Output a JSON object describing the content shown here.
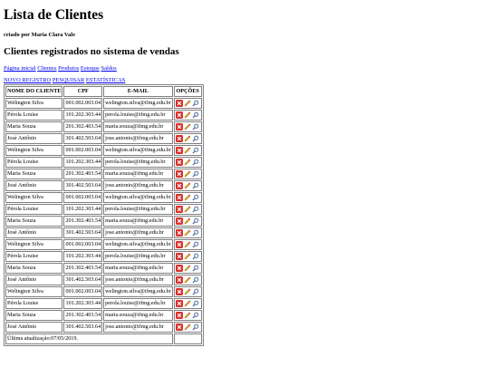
{
  "page": {
    "title": "Lista de Clientes",
    "author": "criado por Maria Clara Vale",
    "subtitle": "Clientes registrados no sistema de vendas"
  },
  "nav": [
    "Página inicial",
    "Clientes",
    "Produtos",
    "Estoque",
    "Saldos"
  ],
  "actions": [
    "NOVO REGISTRO",
    "PESQUISAR",
    "ESTATÍSTICAS"
  ],
  "table": {
    "headers": [
      "NOME DO CLIENTE",
      "CPF",
      "E-MAIL",
      "OPÇÕES"
    ],
    "rows": [
      [
        "Welington Silva",
        "001.002.003.04",
        "welington.silva@ifmg.edu.br"
      ],
      [
        "Pérola Louise",
        "101.202.303.44",
        "perola.louise@ifmg.edu.br"
      ],
      [
        "Maria Souza",
        "201.302.403.54",
        "maria.souza@ifmg.edu.br"
      ],
      [
        "José Antônio",
        "301.402.503.64",
        "jose.antonio@ifmg.edu.br"
      ],
      [
        "Welington Silva",
        "001.002.003.04",
        "welington.silva@ifmg.edu.br"
      ],
      [
        "Pérola Louise",
        "101.202.303.44",
        "perola.louise@ifmg.edu.br"
      ],
      [
        "Maria Souza",
        "201.302.403.54",
        "maria.souza@ifmg.edu.br"
      ],
      [
        "José Antônio",
        "301.402.503.64",
        "jose.antonio@ifmg.edu.br"
      ],
      [
        "Welington Silva",
        "001.002.003.04",
        "welington.silva@ifmg.edu.br"
      ],
      [
        "Pérola Louise",
        "101.202.303.44",
        "perola.louise@ifmg.edu.br"
      ],
      [
        "Maria Souza",
        "201.302.403.54",
        "maria.souza@ifmg.edu.br"
      ],
      [
        "José Antônio",
        "301.402.503.64",
        "jose.antonio@ifmg.edu.br"
      ],
      [
        "Welington Silva",
        "001.002.003.04",
        "welington.silva@ifmg.edu.br"
      ],
      [
        "Pérola Louise",
        "101.202.303.44",
        "perola.louise@ifmg.edu.br"
      ],
      [
        "Maria Souza",
        "201.302.403.54",
        "maria.souza@ifmg.edu.br"
      ],
      [
        "José Antônio",
        "301.402.503.64",
        "jose.antonio@ifmg.edu.br"
      ],
      [
        "Welington Silva",
        "001.002.003.04",
        "welington.silva@ifmg.edu.br"
      ],
      [
        "Pérola Louise",
        "101.202.303.44",
        "perola.louise@ifmg.edu.br"
      ],
      [
        "Maria Souza",
        "201.302.403.54",
        "maria.souza@ifmg.edu.br"
      ],
      [
        "José Antônio",
        "301.402.503.64",
        "jose.antonio@ifmg.edu.br"
      ]
    ],
    "row_icons": [
      "delete-icon",
      "edit-pencil-icon",
      "search-magnifier-icon"
    ],
    "footer": "Última atualização:07/05/2019."
  },
  "colors": {
    "link": "#0000ee",
    "delete": "#d9302c",
    "pencil": "#e0a020",
    "border": "#808080"
  }
}
